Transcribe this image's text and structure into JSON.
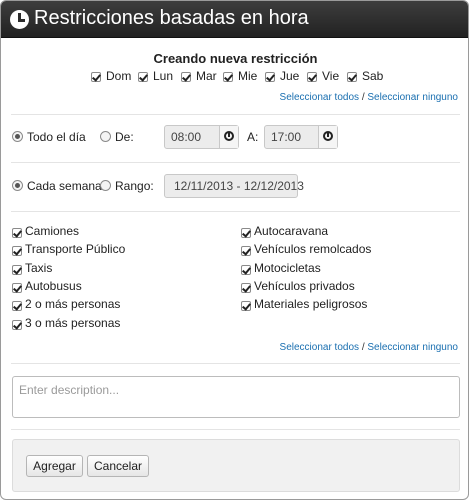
{
  "window": {
    "title": "Restricciones basadas en hora",
    "icon": "clock-icon"
  },
  "heading": "Creando nueva restricción",
  "days": [
    {
      "label": "Dom",
      "checked": true
    },
    {
      "label": "Lun",
      "checked": true
    },
    {
      "label": "Mar",
      "checked": true
    },
    {
      "label": "Mie",
      "checked": true
    },
    {
      "label": "Jue",
      "checked": true
    },
    {
      "label": "Vie",
      "checked": true
    },
    {
      "label": "Sab",
      "checked": true
    }
  ],
  "select_links": {
    "all": "Seleccionar todos",
    "separator": "/",
    "none": "Seleccionar ninguno"
  },
  "time": {
    "all_day_label": "Todo el día",
    "from_label": "De:",
    "from_value": "08:00",
    "to_label": "A:",
    "to_value": "17:00",
    "selected": "all_day"
  },
  "period": {
    "weekly_label": "Cada semana",
    "range_label": "Rango:",
    "range_value": "12/11/2013 - 12/12/2013",
    "selected": "weekly"
  },
  "vehicles_left": [
    {
      "label": "Camiones",
      "checked": true
    },
    {
      "label": "Transporte Público",
      "checked": true
    },
    {
      "label": "Taxis",
      "checked": true
    },
    {
      "label": "Autobusus",
      "checked": true
    },
    {
      "label": "2 o más personas",
      "checked": true
    },
    {
      "label": "3 o más personas",
      "checked": true
    }
  ],
  "vehicles_right": [
    {
      "label": "Autocaravana",
      "checked": true
    },
    {
      "label": "Vehículos remolcados",
      "checked": true
    },
    {
      "label": "Motocicletas",
      "checked": true
    },
    {
      "label": "Vehículos privados",
      "checked": true
    },
    {
      "label": "Materiales peligrosos",
      "checked": true
    }
  ],
  "description": {
    "placeholder": "Enter description...",
    "value": ""
  },
  "buttons": {
    "add": "Agregar",
    "cancel": "Cancelar"
  }
}
